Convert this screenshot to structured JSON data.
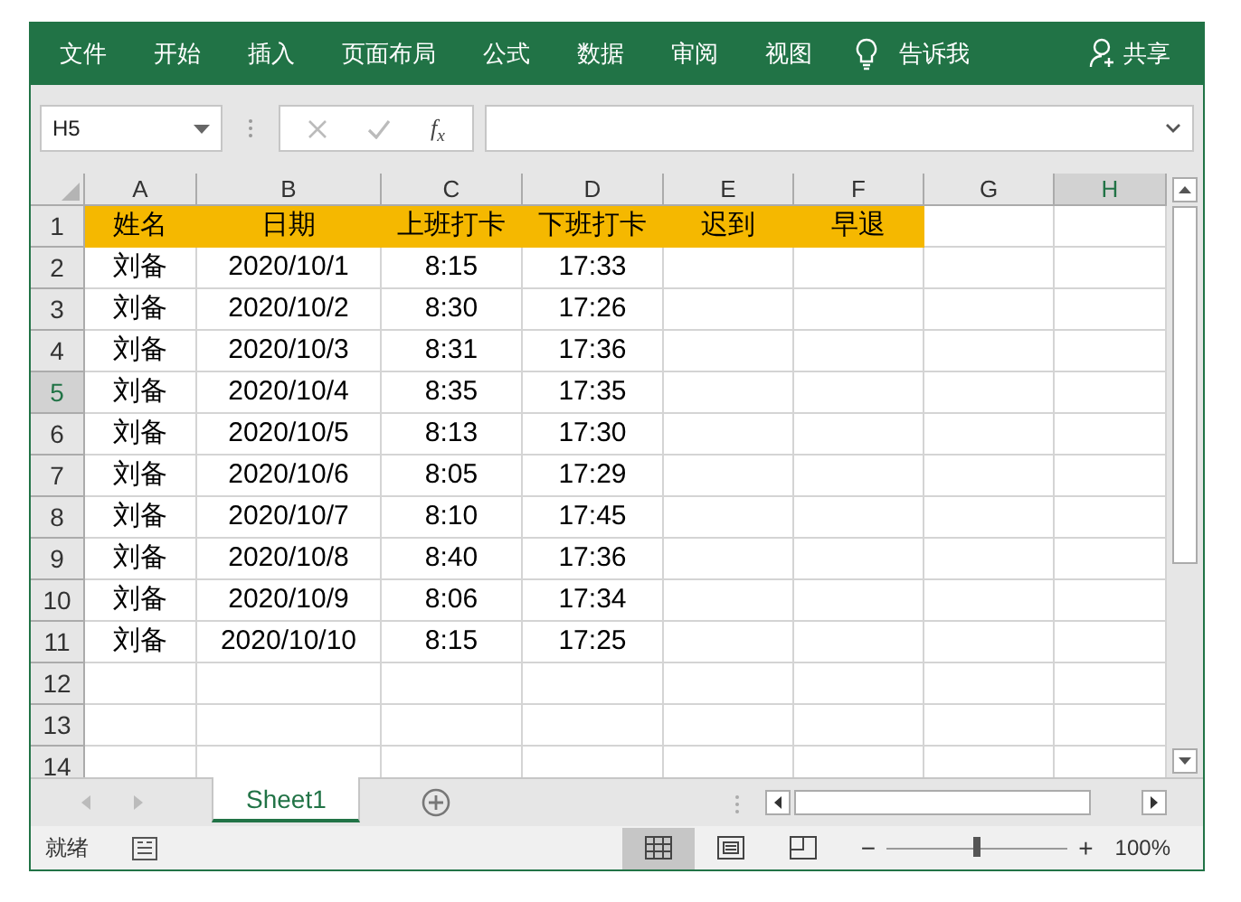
{
  "ribbon": {
    "tabs": [
      {
        "label": "文件"
      },
      {
        "label": "开始"
      },
      {
        "label": "插入"
      },
      {
        "label": "页面布局"
      },
      {
        "label": "公式"
      },
      {
        "label": "数据"
      },
      {
        "label": "审阅"
      },
      {
        "label": "视图"
      }
    ],
    "tell_me": "告诉我",
    "share": "共享"
  },
  "formula_bar": {
    "name_box": "H5",
    "fx": "f$_{x}$"
  },
  "sheet": {
    "columns": [
      {
        "label": "A",
        "selected": false
      },
      {
        "label": "B",
        "selected": false
      },
      {
        "label": "C",
        "selected": false
      },
      {
        "label": "D",
        "selected": false
      },
      {
        "label": "E",
        "selected": false
      },
      {
        "label": "F",
        "selected": false
      },
      {
        "label": "G",
        "selected": false
      },
      {
        "label": "H",
        "selected": true
      }
    ],
    "rows": [
      {
        "number": "1",
        "selected": false,
        "kind": "header",
        "cells": [
          "姓名",
          "日期",
          "上班打卡",
          "下班打卡",
          "迟到",
          "早退"
        ]
      },
      {
        "number": "2",
        "selected": false,
        "kind": "data",
        "cells": [
          "刘备",
          "2020/10/1",
          "8:15",
          "17:33"
        ]
      },
      {
        "number": "3",
        "selected": false,
        "kind": "data",
        "cells": [
          "刘备",
          "2020/10/2",
          "8:30",
          "17:26"
        ]
      },
      {
        "number": "4",
        "selected": false,
        "kind": "data",
        "cells": [
          "刘备",
          "2020/10/3",
          "8:31",
          "17:36"
        ]
      },
      {
        "number": "5",
        "selected": true,
        "kind": "data",
        "cells": [
          "刘备",
          "2020/10/4",
          "8:35",
          "17:35"
        ]
      },
      {
        "number": "6",
        "selected": false,
        "kind": "data",
        "cells": [
          "刘备",
          "2020/10/5",
          "8:13",
          "17:30"
        ]
      },
      {
        "number": "7",
        "selected": false,
        "kind": "data",
        "cells": [
          "刘备",
          "2020/10/6",
          "8:05",
          "17:29"
        ]
      },
      {
        "number": "8",
        "selected": false,
        "kind": "data",
        "cells": [
          "刘备",
          "2020/10/7",
          "8:10",
          "17:45"
        ]
      },
      {
        "number": "9",
        "selected": false,
        "kind": "data",
        "cells": [
          "刘备",
          "2020/10/8",
          "8:40",
          "17:36"
        ]
      },
      {
        "number": "10",
        "selected": false,
        "kind": "data",
        "cells": [
          "刘备",
          "2020/10/9",
          "8:06",
          "17:34"
        ]
      },
      {
        "number": "11",
        "selected": false,
        "kind": "data",
        "cells": [
          "刘备",
          "2020/10/10",
          "8:15",
          "17:25"
        ]
      },
      {
        "number": "12",
        "selected": false,
        "kind": "data"
      },
      {
        "number": "13",
        "selected": false,
        "kind": "data"
      },
      {
        "number": "14",
        "selected": false,
        "kind": "data"
      }
    ]
  },
  "sheet_tabs": [
    {
      "label": "Sheet1",
      "selected": true
    }
  ],
  "status_bar": {
    "text": "就绪",
    "views": [
      {
        "kind": "normal",
        "selected": true
      },
      {
        "kind": "page_layout",
        "selected": false
      },
      {
        "kind": "page_break",
        "selected": false
      }
    ],
    "zoom_out": "−",
    "zoom_in": "+",
    "zoom_slider": {
      "level": 0.5
    },
    "zoom": "100%"
  }
}
